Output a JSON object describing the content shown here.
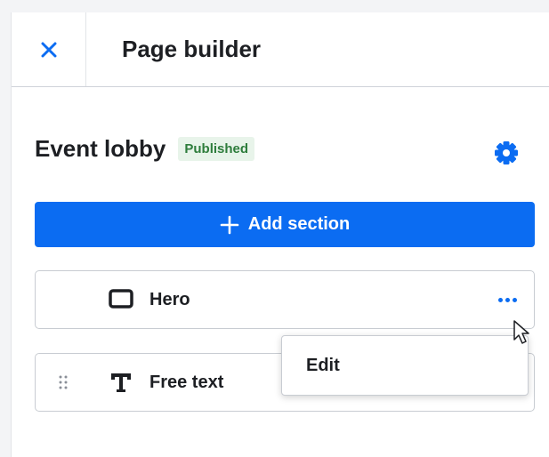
{
  "header": {
    "title": "Page builder",
    "close_icon": "close-icon"
  },
  "page": {
    "title": "Event lobby",
    "status": "Published",
    "settings_icon": "gear-icon"
  },
  "actions": {
    "add_section_label": "Add section",
    "add_icon": "plus-icon"
  },
  "sections": [
    {
      "label": "Hero",
      "icon": "hero-rectangle-icon",
      "menu_icon": "more-horizontal-icon"
    },
    {
      "label": "Free text",
      "icon": "text-t-icon",
      "handle_icon": "drag-handle-icon"
    }
  ],
  "context_menu": {
    "items": [
      {
        "label": "Edit"
      }
    ]
  },
  "colors": {
    "accent": "#0b6cf2",
    "badge_bg": "#e8f4ea",
    "badge_text": "#2e7d3c",
    "text": "#1d1f23"
  }
}
